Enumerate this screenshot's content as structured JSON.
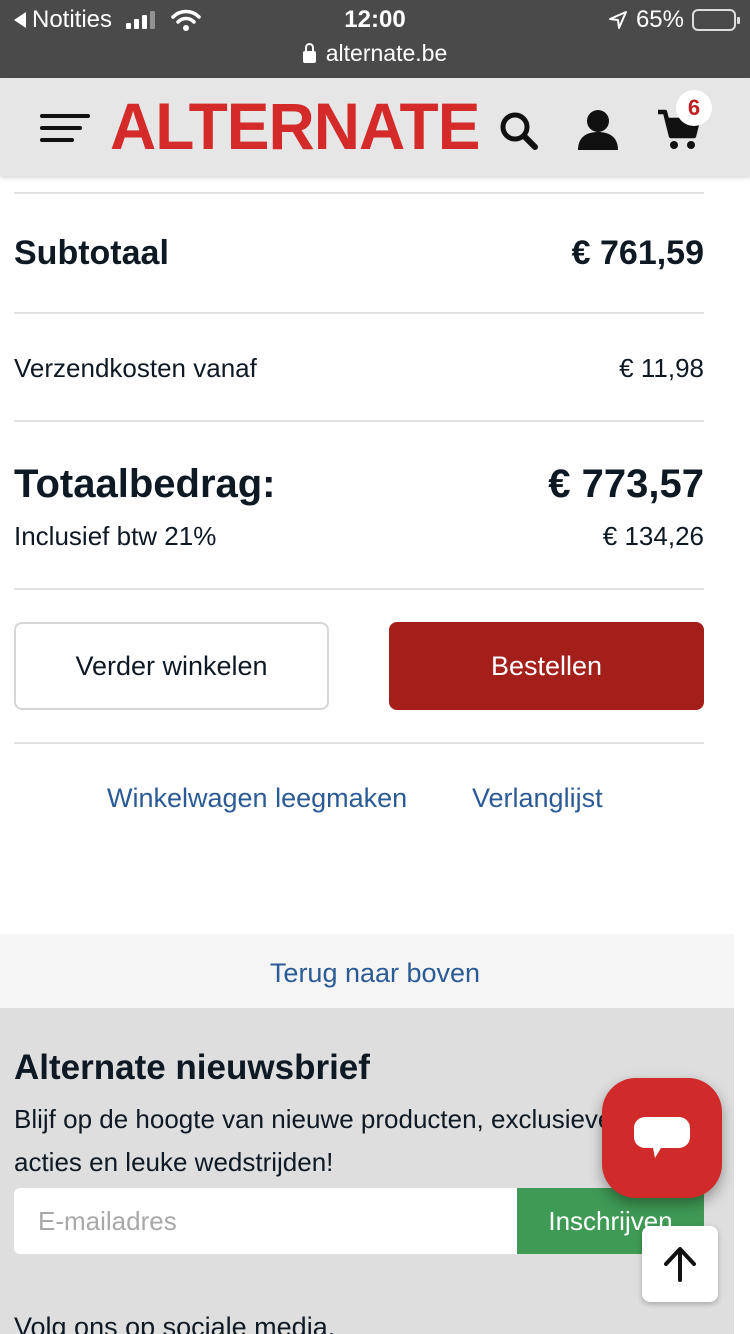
{
  "status_bar": {
    "back_app": "Notities",
    "time": "12:00",
    "battery": "65%",
    "battery_level": 0.65,
    "url": "alternate.be"
  },
  "header": {
    "logo": "ALTERNATE",
    "cart_count": "6",
    "brand_color": "#d42a2a"
  },
  "summary": {
    "subtotal_label": "Subtotaal",
    "subtotal_value": "€ 761,59",
    "shipping_label": "Verzendkosten vanaf",
    "shipping_value": "€ 11,98",
    "total_label": "Totaalbedrag:",
    "total_value": "€ 773,57",
    "vat_label": "Inclusief btw 21%",
    "vat_value": "€ 134,26"
  },
  "actions": {
    "continue_label": "Verder winkelen",
    "order_label": "Bestellen",
    "order_color": "#a41e1a"
  },
  "links": {
    "empty_cart": "Winkelwagen leegmaken",
    "wishlist": "Verlanglijst",
    "back_to_top": "Terug naar boven"
  },
  "newsletter": {
    "title": "Alternate nieuwsbrief",
    "text": "Blijf op de hoogte van nieuwe producten, exclusieve acties en leuke wedstrijden!",
    "email_placeholder": "E-mailadres",
    "subscribe_label": "Inschrijven",
    "subscribe_color": "#3f9a55",
    "social_label": "Volg ons op sociale media."
  },
  "icons": {
    "menu": "hamburger-menu-icon",
    "search": "search-icon",
    "account": "user-icon",
    "cart": "cart-icon",
    "chat": "chat-bubble-icon",
    "scroll_top": "arrow-up-icon"
  }
}
